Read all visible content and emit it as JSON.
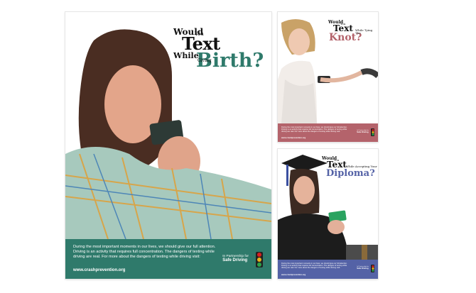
{
  "colors": {
    "teal": "#2f7a6b",
    "rose": "#b4636b",
    "blue": "#5462a6",
    "dark_text": "#111111",
    "light_red": "#d82020",
    "light_yellow": "#e7b21d",
    "light_green": "#2ca24a"
  },
  "posters": {
    "main": {
      "would": "Would",
      "you": "You",
      "text": "Text",
      "while": "While",
      "doing": "Giving",
      "key": "Birth?",
      "body": "During the most important moments in our lives, we should give our full attention. Driving is an activity that requires full concentration. The dangers of texting while driving are real. For more about the dangers of texting while driving visit:",
      "url": "www.crashprevention.org",
      "partner_line": "In Partnership for",
      "partner_org": "Safe Driving"
    },
    "wedding": {
      "would": "Would",
      "you": "You",
      "text": "Text",
      "doing": "While Tying The",
      "key": "Knot?",
      "body": "During the most important moments in our lives, we should give our full attention. Driving is an activity that requires full concentration. The dangers of texting while driving are real. For more about the dangers of texting while driving visit:",
      "url": "www.crashprevention.org",
      "partner_line": "In Partnership for",
      "partner_org": "Safe Driving"
    },
    "grad": {
      "would": "Would",
      "you": "You",
      "text": "Text",
      "doing": "While Accepting Your",
      "key": "Diploma?",
      "body": "During the most important moments in our lives, we should give our full attention. Driving is an activity that requires full concentration. The dangers of texting while driving are real. For more about the dangers of texting while driving visit:",
      "url": "www.crashprevention.org",
      "partner_line": "In Partnership for",
      "partner_org": "Safe Driving"
    }
  }
}
